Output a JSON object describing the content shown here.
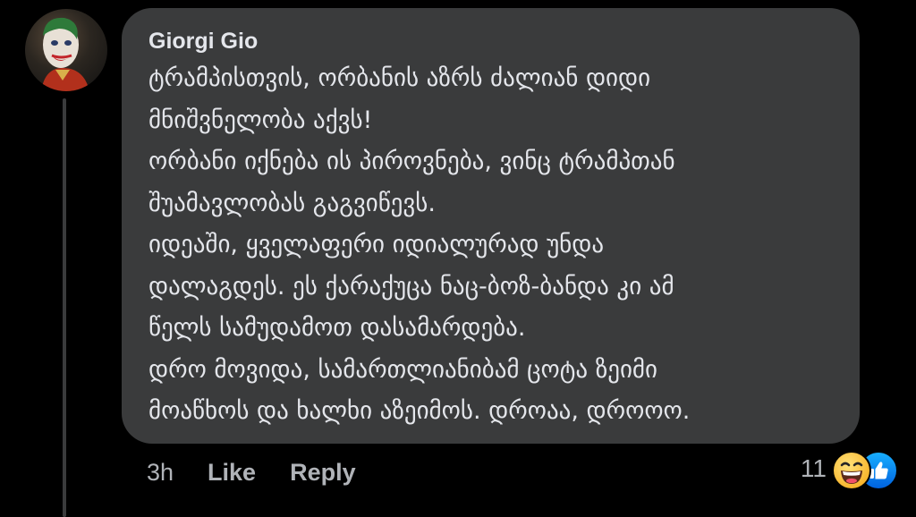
{
  "comment": {
    "author": "Giorgi Gio",
    "lines": [
      "ტრამპისთვის, ორბანის აზრს ძალიან დიდი",
      "მნიშვნელობა აქვს!",
      "ორბანი იქნება ის პიროვნება, ვინც ტრამპთან",
      "შუამავლობას გაგვიწევს.",
      "იდეაში, ყველაფერი იდიალურად უნდა",
      "დალაგდეს. ეს ქარაქუცა ნაც-ბოზ-ბანდა კი ამ",
      "წელს სამუდამოთ დასამარდება.",
      "დრო მოვიდა, სამართლიანიბამ ცოტა ზეიმი",
      "მოაწხოს და ხალხი აზეიმოს. დროაა, დროოო."
    ]
  },
  "actions": {
    "time": "3h",
    "like": "Like",
    "reply": "Reply"
  },
  "reactions": {
    "count": "11",
    "icons": [
      "haha-reaction-icon",
      "like-reaction-icon"
    ]
  },
  "colors": {
    "background": "#000000",
    "bubble": "#3a3b3c",
    "text": "#e4e6eb",
    "secondary_text": "#b0b3b8",
    "like_blue": "#1877f2",
    "haha_yellow": "#f7b125"
  }
}
